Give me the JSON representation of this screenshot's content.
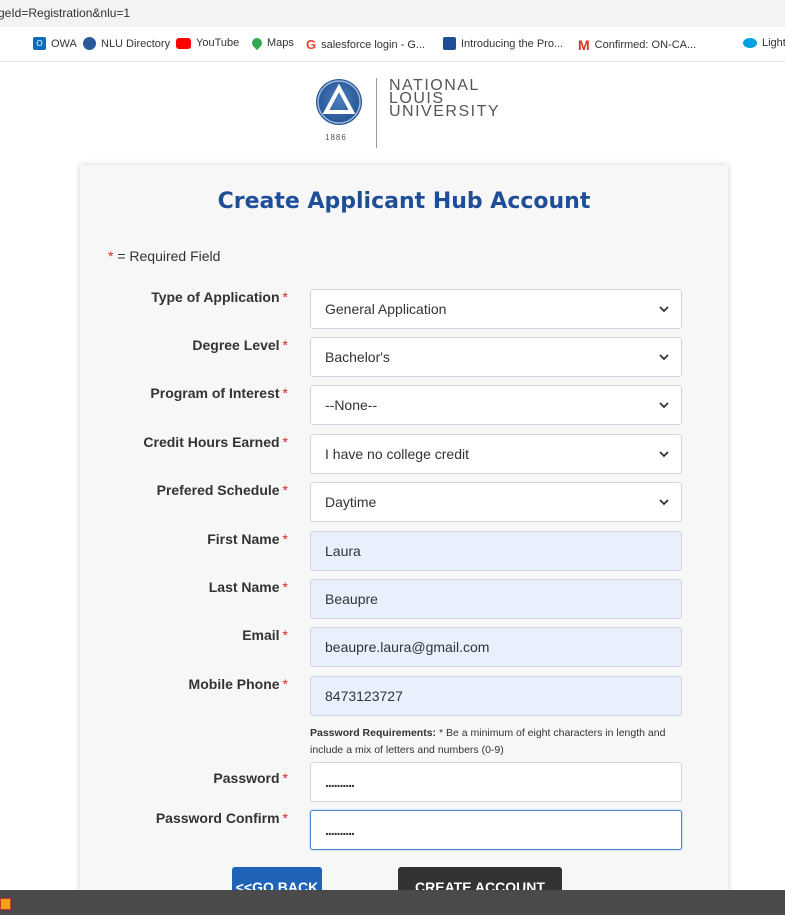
{
  "browser": {
    "url_fragment": "geId=Registration&nlu=1",
    "bookmarks": [
      {
        "label": "OWA",
        "icon": "outlook-icon",
        "color": "#0f6cbd"
      },
      {
        "label": "NLU Directory",
        "icon": "nlu-icon",
        "color": "#2b5a9a"
      },
      {
        "label": "YouTube",
        "icon": "youtube-icon",
        "color": "#ff0000"
      },
      {
        "label": "Maps",
        "icon": "maps-pin-icon",
        "color": "#34a853"
      },
      {
        "label": "salesforce login - G...",
        "icon": "google-icon",
        "color": "#ea4335"
      },
      {
        "label": "Introducing the Pro...",
        "icon": "grid-icon",
        "color": "#1f4e99"
      },
      {
        "label": "Confirmed: ON-CA...",
        "icon": "gmail-icon",
        "color": "#d93025"
      },
      {
        "label": "Light",
        "icon": "salesforce-cloud-icon",
        "color": "#00a1e0"
      }
    ]
  },
  "logo": {
    "year": "1886",
    "line1": "NATIONAL",
    "line2": "LOUIS",
    "line3": "UNIVERSITY"
  },
  "form": {
    "title": "Create Applicant Hub Account",
    "required_note": "= Required Field",
    "required_marker": "*",
    "fields": [
      {
        "label": "Type of Application",
        "value": "General Application",
        "kind": "select"
      },
      {
        "label": "Degree Level",
        "value": "Bachelor's",
        "kind": "select"
      },
      {
        "label": "Program of Interest",
        "value": "--None--",
        "kind": "select"
      },
      {
        "label": "Credit Hours Earned",
        "value": "I have no college credit",
        "kind": "select"
      },
      {
        "label": "Prefered Schedule",
        "value": "Daytime",
        "kind": "select"
      },
      {
        "label": "First Name",
        "value": "Laura",
        "kind": "text"
      },
      {
        "label": "Last Name",
        "value": "Beaupre",
        "kind": "text"
      },
      {
        "label": "Email",
        "value": "beaupre.laura@gmail.com",
        "kind": "text"
      },
      {
        "label": "Mobile Phone",
        "value": "8473123727",
        "kind": "text"
      }
    ],
    "password_requirements_label": "Password Requirements:",
    "password_requirements_text": "* Be a minimum of eight characters in length and include a mix of letters and numbers (0-9)",
    "password_label": "Password",
    "password_value": "..........",
    "password_confirm_label": "Password Confirm",
    "password_confirm_value": "..........",
    "go_back_label": "<<GO BACK",
    "create_label": "CREATE ACCOUNT"
  },
  "colors": {
    "title": "#1f4e99",
    "required": "#d62828",
    "autofill": "#e8f0fe",
    "go_back": "#1f63b8",
    "create": "#333333"
  }
}
